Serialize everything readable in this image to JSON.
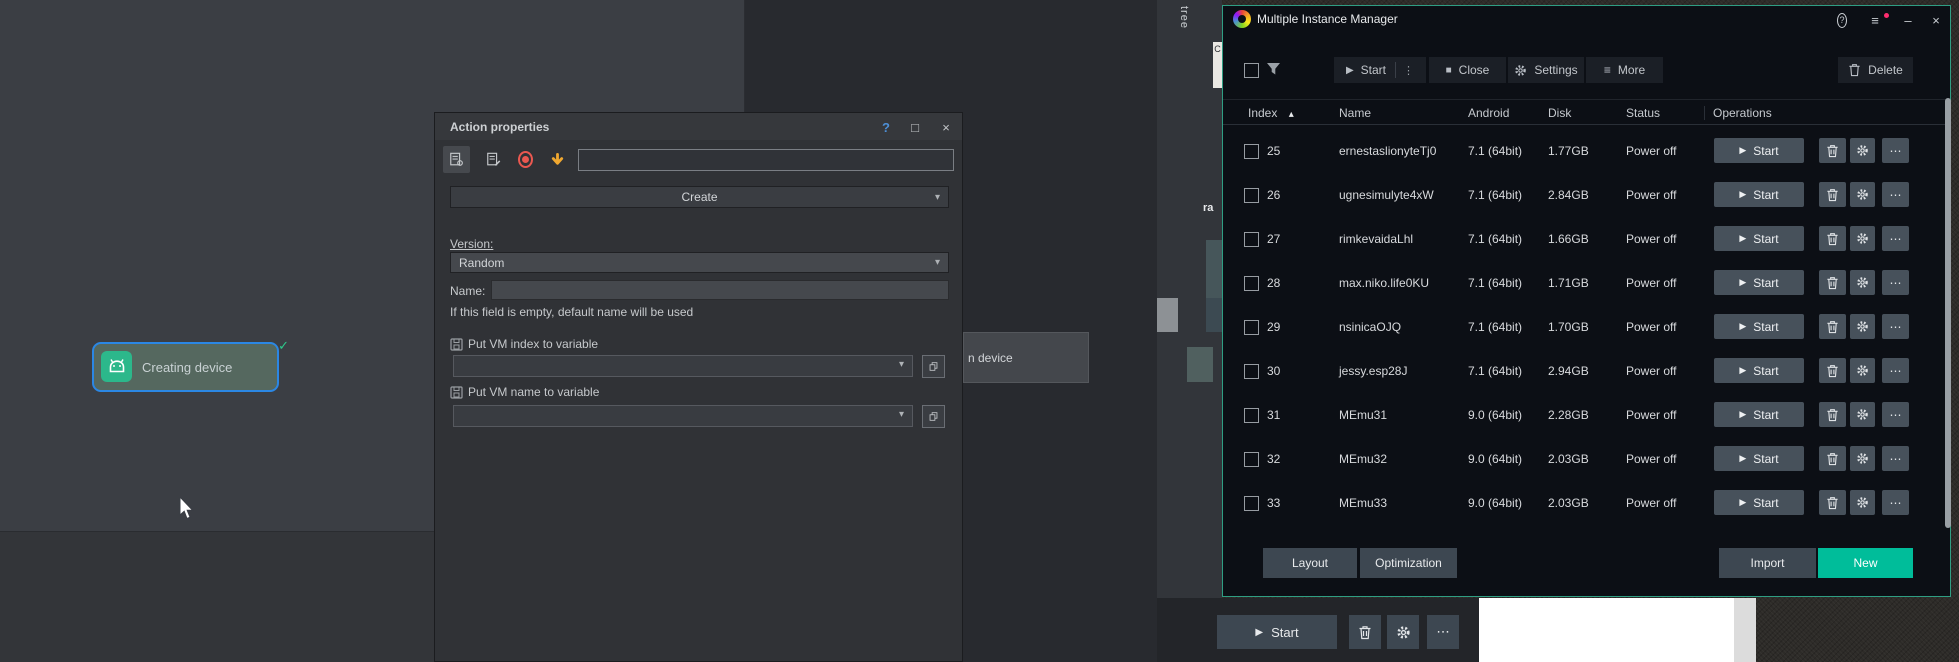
{
  "icons": {
    "play": "▶",
    "stop": "■",
    "menu": "≡",
    "kebab": "⋮",
    "ellipsis": "⋯",
    "caret_down": "▾",
    "sort_asc": "▴",
    "check": "✓",
    "help": "?",
    "minimize": "–",
    "maximize": "□",
    "close": "×"
  },
  "background_window": {
    "tree_tab_label": "tree",
    "partial_letter": "C",
    "partial_text": "ra",
    "partial_item_label": "n device",
    "start_label": "Start",
    "node_label": "Creating device"
  },
  "dialog": {
    "title": "Action properties",
    "search_value": "",
    "action_select": "Create",
    "version_label": "Version:",
    "version_value": "Random",
    "name_label": "Name:",
    "name_value": "",
    "hint": "If this field is empty, default name will be used",
    "vm_index_label": "Put VM index to variable",
    "vm_index_value": "",
    "vm_name_label": "Put VM name to variable",
    "vm_name_value": ""
  },
  "manager": {
    "title": "Multiple Instance Manager",
    "toolbar": {
      "start": "Start",
      "close": "Close",
      "settings": "Settings",
      "more": "More",
      "delete": "Delete"
    },
    "columns": [
      "Index",
      "Name",
      "Android",
      "Disk",
      "Status",
      "Operations"
    ],
    "row_start_label": "Start",
    "rows": [
      {
        "index": "25",
        "name": "ernestaslionyteTj0",
        "android": "7.1 (64bit)",
        "disk": "1.77GB",
        "status": "Power off"
      },
      {
        "index": "26",
        "name": "ugnesimulyte4xW",
        "android": "7.1 (64bit)",
        "disk": "2.84GB",
        "status": "Power off"
      },
      {
        "index": "27",
        "name": "rimkevaidaLhl",
        "android": "7.1 (64bit)",
        "disk": "1.66GB",
        "status": "Power off"
      },
      {
        "index": "28",
        "name": "max.niko.life0KU",
        "android": "7.1 (64bit)",
        "disk": "1.71GB",
        "status": "Power off"
      },
      {
        "index": "29",
        "name": "nsinicaOJQ",
        "android": "7.1 (64bit)",
        "disk": "1.70GB",
        "status": "Power off"
      },
      {
        "index": "30",
        "name": "jessy.esp28J",
        "android": "7.1 (64bit)",
        "disk": "2.94GB",
        "status": "Power off"
      },
      {
        "index": "31",
        "name": "MEmu31",
        "android": "9.0 (64bit)",
        "disk": "2.28GB",
        "status": "Power off"
      },
      {
        "index": "32",
        "name": "MEmu32",
        "android": "9.0 (64bit)",
        "disk": "2.03GB",
        "status": "Power off"
      },
      {
        "index": "33",
        "name": "MEmu33",
        "android": "9.0 (64bit)",
        "disk": "2.03GB",
        "status": "Power off"
      }
    ],
    "footer": {
      "layout": "Layout",
      "optimization": "Optimization",
      "import": "Import",
      "new": "New"
    },
    "colors": {
      "accent_teal": "#00bd9a",
      "window_border": "#2f9e83",
      "notification_dot": "#ff2d6f",
      "node_border_blue": "#2b87e4"
    }
  }
}
